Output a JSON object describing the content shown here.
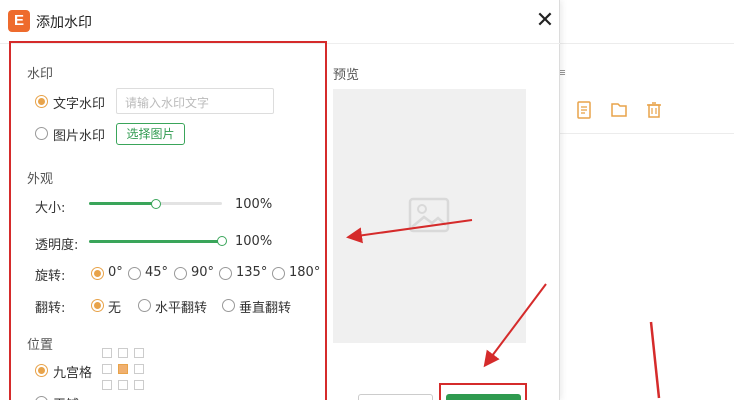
{
  "dialog": {
    "title": "添加水印",
    "close_glyph": "✕"
  },
  "watermark": {
    "section_label": "水印",
    "text_option": "文字水印",
    "text_placeholder": "请输入水印文字",
    "image_option": "图片水印",
    "select_image_button": "选择图片",
    "selected": "text"
  },
  "appearance": {
    "section_label": "外观",
    "size_label": "大小:",
    "size_value_text": "100%",
    "size_level": 0.5,
    "opacity_label": "透明度:",
    "opacity_value_text": "100%",
    "opacity_level": 1.0,
    "rotation_label": "旋转:",
    "rotation_options": [
      "0°",
      "45°",
      "90°",
      "135°",
      "180°"
    ],
    "rotation_selected": "0°",
    "flip_label": "翻转:",
    "flip_options": [
      "无",
      "水平翻转",
      "垂直翻转"
    ],
    "flip_selected": "无"
  },
  "position": {
    "section_label": "位置",
    "grid_option": "九宫格",
    "second_option": "平铺",
    "selected": "grid",
    "grid_selected_cell": 4
  },
  "preview": {
    "label": "预览",
    "placeholder_icon": "image-icon"
  },
  "colors": {
    "accent_green": "#3aa55a",
    "accent_orange": "#e8a34a",
    "highlight_red": "#d52b2b",
    "app_brand": "#ee6b2d"
  },
  "background_app": {
    "toolbar_icons": [
      "document-icon",
      "folder-icon",
      "trash-icon"
    ],
    "overflow_glyph": "≡"
  }
}
